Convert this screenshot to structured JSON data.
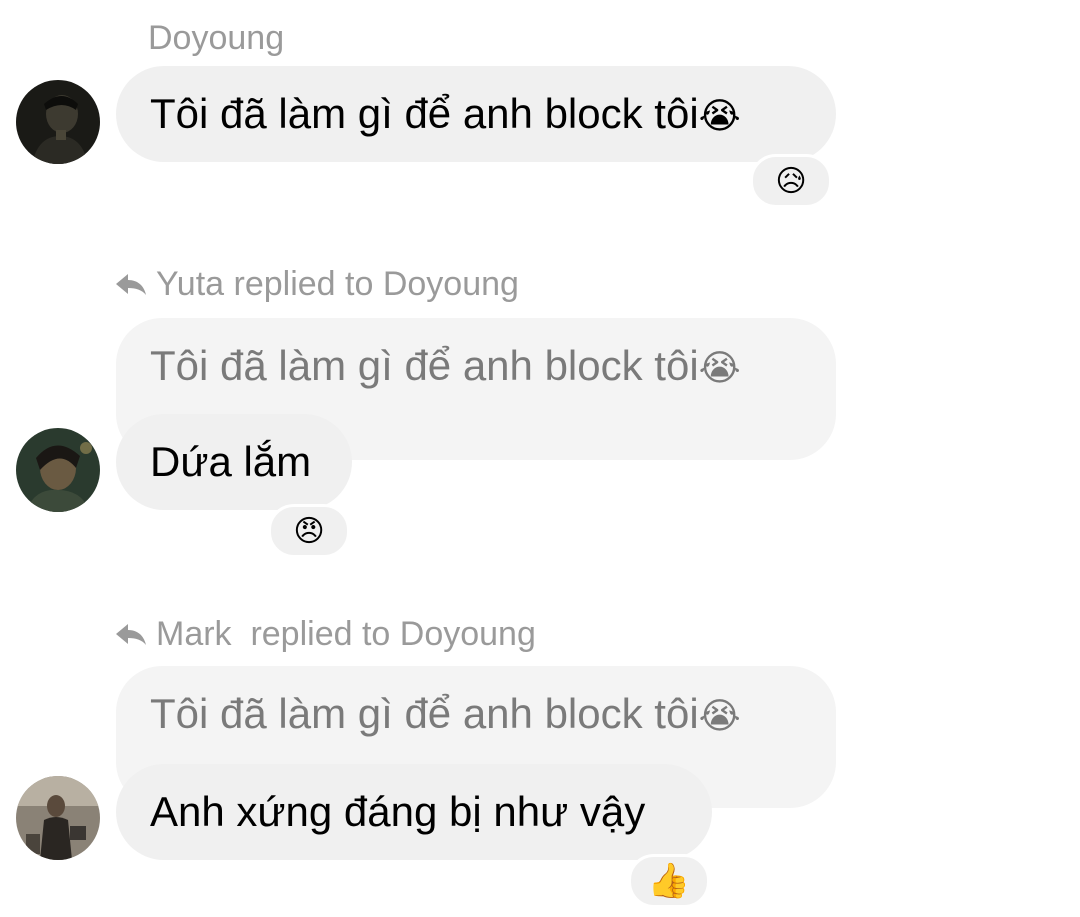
{
  "messages": [
    {
      "sender": "Doyoung",
      "text": "Tôi đã làm gì để anh block tôi",
      "emoji": "😭",
      "reaction": "😥"
    },
    {
      "reply_header": "Yuta replied to Doyoung",
      "quoted_text": "Tôi đã làm gì để anh block tôi",
      "quoted_emoji": "😭",
      "text": "Dứa lắm",
      "reaction": "😠"
    },
    {
      "reply_header": "Mark  replied to Doyoung",
      "quoted_text": "Tôi đã làm gì để anh block tôi",
      "quoted_emoji": "😭",
      "text": "Anh xứng đáng bị như vậy",
      "reaction": "👍"
    }
  ]
}
